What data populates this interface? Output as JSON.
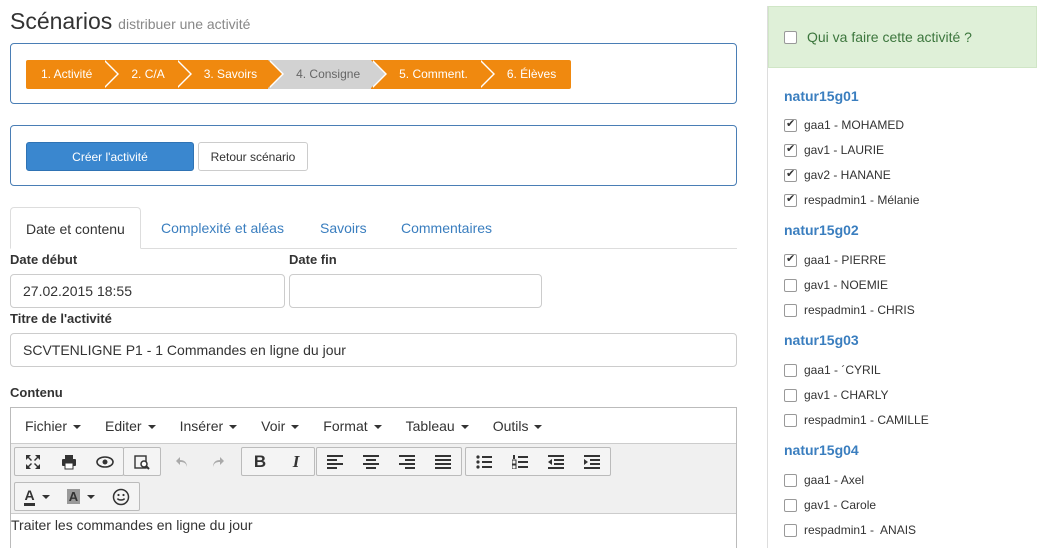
{
  "header": {
    "title": "Scénarios",
    "subtitle": "distribuer une activité"
  },
  "wizard": {
    "steps": [
      {
        "label": "1. Activité",
        "active": true
      },
      {
        "label": "2. C/A",
        "active": true
      },
      {
        "label": "3. Savoirs",
        "active": true
      },
      {
        "label": "4. Consigne",
        "active": false
      },
      {
        "label": "5. Comment.",
        "active": true
      },
      {
        "label": "6. Élèves",
        "active": true
      }
    ]
  },
  "actions": {
    "create_label": "Créer l'activité",
    "back_label": "Retour scénario"
  },
  "tabs": [
    {
      "label": "Date et contenu",
      "active": true
    },
    {
      "label": "Complexité et aléas",
      "active": false
    },
    {
      "label": "Savoirs",
      "active": false
    },
    {
      "label": "Commentaires",
      "active": false
    }
  ],
  "form": {
    "date_start_label": "Date début",
    "date_start_value": "27.02.2015 18:55",
    "date_end_label": "Date fin",
    "date_end_value": "",
    "title_label": "Titre de l'activité",
    "title_value": "SCVTENLIGNE P1 - 1 Commandes en ligne du jour",
    "content_label": "Contenu"
  },
  "editor": {
    "menus": [
      "Fichier",
      "Editer",
      "Insérer",
      "Voir",
      "Format",
      "Tableau",
      "Outils"
    ],
    "icons": [
      "fullscreen-icon",
      "print-icon",
      "preview-icon",
      "find-icon",
      "undo-icon",
      "redo-icon",
      "bold-icon",
      "italic-icon",
      "align-left-icon",
      "align-center-icon",
      "align-right-icon",
      "align-justify-icon",
      "bullet-list-icon",
      "numbered-list-icon",
      "outdent-icon",
      "indent-icon",
      "text-color-icon",
      "background-color-icon",
      "emoticon-icon"
    ],
    "bold_glyph": "B",
    "italic_glyph": "I",
    "text_color_glyph": "A",
    "bg_color_glyph": "A",
    "body": "Traiter les commandes en ligne du jour"
  },
  "side": {
    "header": "Qui va faire cette activité ?",
    "groups": [
      {
        "name": "natur15g01",
        "students": [
          {
            "label": "gaa1 - MOHAMED",
            "checked": true
          },
          {
            "label": "gav1 - LAURIE",
            "checked": true
          },
          {
            "label": "gav2 - HANANE",
            "checked": true
          },
          {
            "label": "respadmin1 - Mélanie",
            "checked": true
          }
        ]
      },
      {
        "name": "natur15g02",
        "students": [
          {
            "label": "gaa1 - PIERRE",
            "checked": true
          },
          {
            "label": "gav1 - NOEMIE",
            "checked": false
          },
          {
            "label": "respadmin1 - CHRIS",
            "checked": false
          }
        ]
      },
      {
        "name": "natur15g03",
        "students": [
          {
            "label": "gaa1 - ´CYRIL",
            "checked": false
          },
          {
            "label": "gav1 - CHARLY",
            "checked": false
          },
          {
            "label": "respadmin1 - CAMILLE",
            "checked": false
          }
        ]
      },
      {
        "name": "natur15g04",
        "students": [
          {
            "label": "gaa1 - Axel",
            "checked": false
          },
          {
            "label": "gav1 - Carole",
            "checked": false
          },
          {
            "label": "respadmin1 -  ANAIS",
            "checked": false
          }
        ]
      }
    ]
  },
  "colors": {
    "accent": "#3a7ebf",
    "wizard_active": "#f0890f",
    "wizard_inactive": "#d2d2d2",
    "primary_button": "#3a87cf",
    "success_bg": "#dff0d8"
  }
}
